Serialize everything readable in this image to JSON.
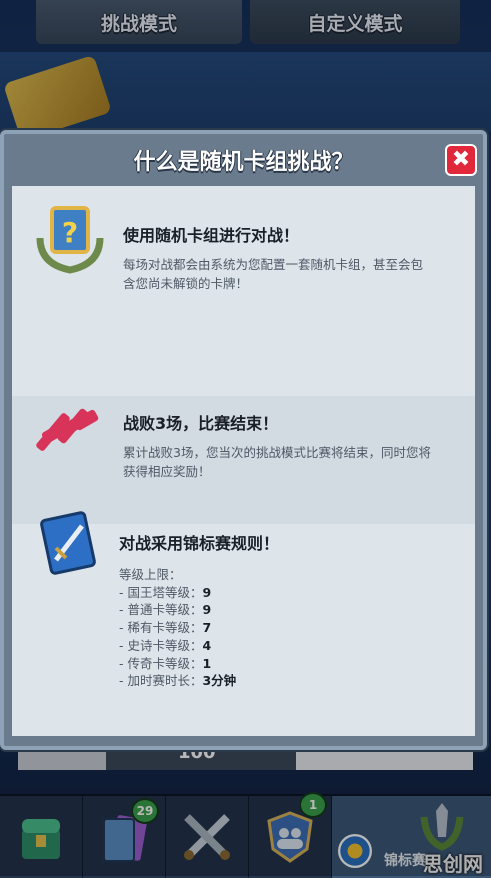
{
  "tabs": {
    "challenge_mode": "挑战模式",
    "custom_mode": "自定义模式"
  },
  "background": {
    "bottom_value": "100"
  },
  "modal": {
    "title": "什么是随机卡组挑战？",
    "close_symbol": "✖",
    "sections": [
      {
        "title": "使用随机卡组进行对战！",
        "body": "每场对战都会由系统为您配置一套随机卡组，甚至会包含您尚未解锁的卡牌！"
      },
      {
        "title": "战败3场，比赛结束！",
        "body": "累计战败3场，您当次的挑战模式比赛将结束，同时您将获得相应奖励！"
      },
      {
        "title": "对战采用锦标赛规则！",
        "rules_heading": "等级上限：",
        "rules": [
          {
            "label": "- 国王塔等级：",
            "value": "9"
          },
          {
            "label": "- 普通卡等级：",
            "value": "9"
          },
          {
            "label": "- 稀有卡等级：",
            "value": "7"
          },
          {
            "label": "- 史诗卡等级：",
            "value": "4"
          },
          {
            "label": "- 传奇卡等级：",
            "value": "1"
          },
          {
            "label": "- 加时赛时长：",
            "value": "3分钟"
          }
        ]
      }
    ]
  },
  "nav": {
    "cards_badge": "29",
    "clan_badge": "1",
    "tournaments_label": "锦标赛"
  },
  "watermark": "思创网",
  "colors": {
    "close_red": "#e0283a",
    "badge_green": "#3aa14c",
    "modal_frame": "#8ea2b7"
  }
}
